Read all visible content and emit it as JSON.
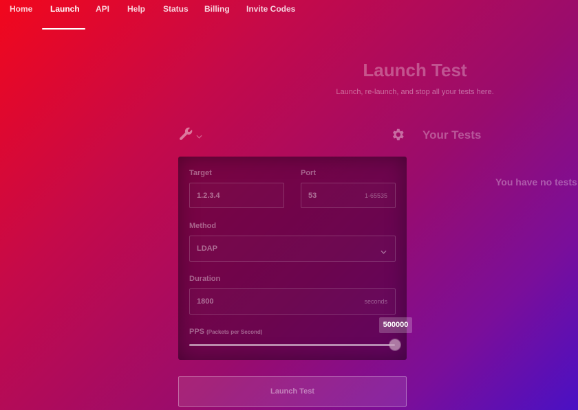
{
  "nav": {
    "items": [
      {
        "label": "Home"
      },
      {
        "label": "Launch",
        "active": true
      },
      {
        "label": "API"
      },
      {
        "label": "Help"
      },
      {
        "label": "Status"
      },
      {
        "label": "Billing"
      },
      {
        "label": "Invite Codes"
      }
    ]
  },
  "header": {
    "title": "Launch Test",
    "subtitle": "Launch, re-launch, and stop all your tests here."
  },
  "tools": {
    "wrench_icon": "wrench-icon",
    "dropdown_icon": "chevron-down-icon",
    "settings_icon": "gear-icon"
  },
  "form": {
    "target": {
      "label": "Target",
      "value": "1.2.3.4"
    },
    "port": {
      "label": "Port",
      "value": "53",
      "hint": "1-65535"
    },
    "method": {
      "label": "Method",
      "value": "LDAP"
    },
    "duration": {
      "label": "Duration",
      "value": "1800",
      "hint": "seconds"
    },
    "pps": {
      "label": "PPS",
      "sublabel": "(Packets per Second)",
      "value": "500000",
      "fraction": 1.0
    }
  },
  "tests": {
    "title": "Your Tests",
    "empty_message": "You have no tests"
  },
  "launch_button": {
    "label": "Launch Test"
  },
  "colors": {
    "gradient_start": "#f2071c",
    "gradient_end": "#4a10c4",
    "panel": "#4a0a3c"
  }
}
